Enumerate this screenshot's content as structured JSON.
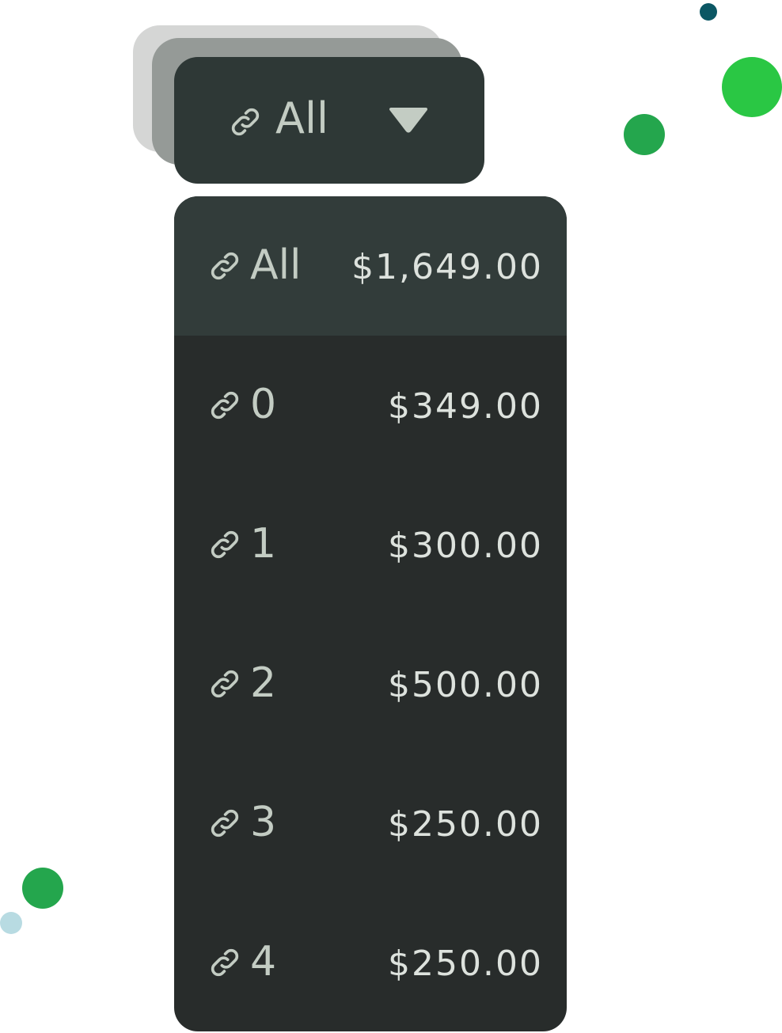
{
  "colors": {
    "accent_green": "#2ac744",
    "dark_green": "#24a64d",
    "teal": "#0b5764",
    "light_blue": "#b8dbe2",
    "panel_bg": "#282c2b",
    "selected_bg": "#323c3a",
    "trigger_bg": "#2e3836",
    "text": "#c3ccc3"
  },
  "dropdown": {
    "icon": "link-icon",
    "selected_label": "All",
    "caret_icon": "caret-down-icon"
  },
  "menu": {
    "items": [
      {
        "label": "All",
        "value": "$1,649.00",
        "selected": true,
        "icon": "link-icon"
      },
      {
        "label": "0",
        "value": "$349.00",
        "selected": false,
        "icon": "link-icon"
      },
      {
        "label": "1",
        "value": "$300.00",
        "selected": false,
        "icon": "link-icon"
      },
      {
        "label": "2",
        "value": "$500.00",
        "selected": false,
        "icon": "link-icon"
      },
      {
        "label": "3",
        "value": "$250.00",
        "selected": false,
        "icon": "link-icon"
      },
      {
        "label": "4",
        "value": "$250.00",
        "selected": false,
        "icon": "link-icon"
      }
    ]
  }
}
